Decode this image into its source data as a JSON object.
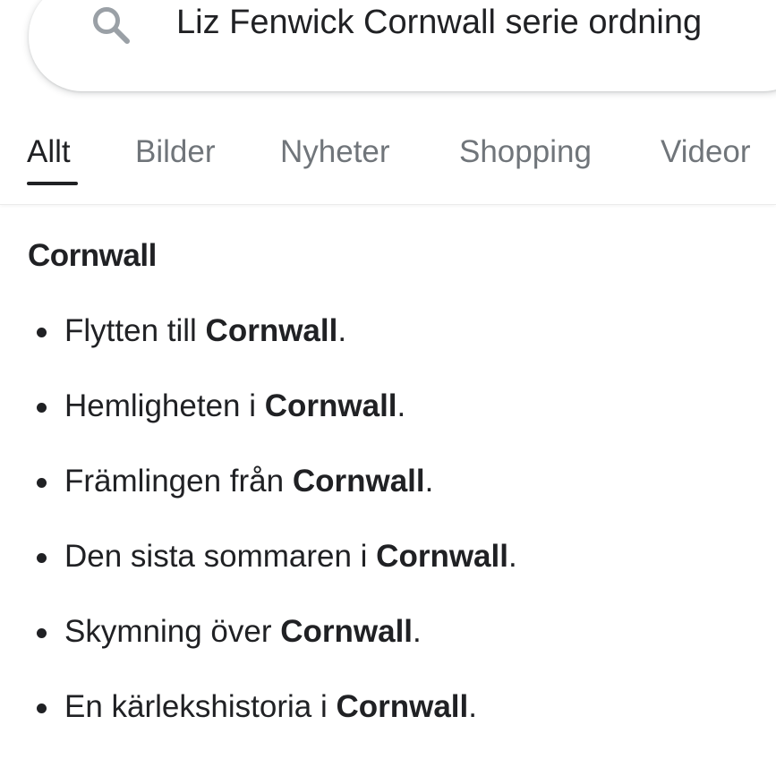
{
  "search": {
    "query": "Liz Fenwick Cornwall serie ordning",
    "icon": "search-icon"
  },
  "tabs": [
    {
      "label": "Allt",
      "active": true
    },
    {
      "label": "Bilder",
      "active": false
    },
    {
      "label": "Nyheter",
      "active": false
    },
    {
      "label": "Shopping",
      "active": false
    },
    {
      "label": "Videor",
      "active": false
    }
  ],
  "result": {
    "heading": "Cornwall",
    "items": [
      {
        "prefix": "Flytten till ",
        "bold": "Cornwall",
        "suffix": "."
      },
      {
        "prefix": "Hemligheten i ",
        "bold": "Cornwall",
        "suffix": "."
      },
      {
        "prefix": "Främlingen från ",
        "bold": "Cornwall",
        "suffix": "."
      },
      {
        "prefix": "Den sista sommaren i ",
        "bold": "Cornwall",
        "suffix": "."
      },
      {
        "prefix": "Skymning över ",
        "bold": "Cornwall",
        "suffix": "."
      },
      {
        "prefix": "En kärlekshistoria i ",
        "bold": "Cornwall",
        "suffix": "."
      }
    ]
  },
  "colors": {
    "text": "#202124",
    "muted": "#70757a",
    "icon": "#9aa0a6"
  }
}
